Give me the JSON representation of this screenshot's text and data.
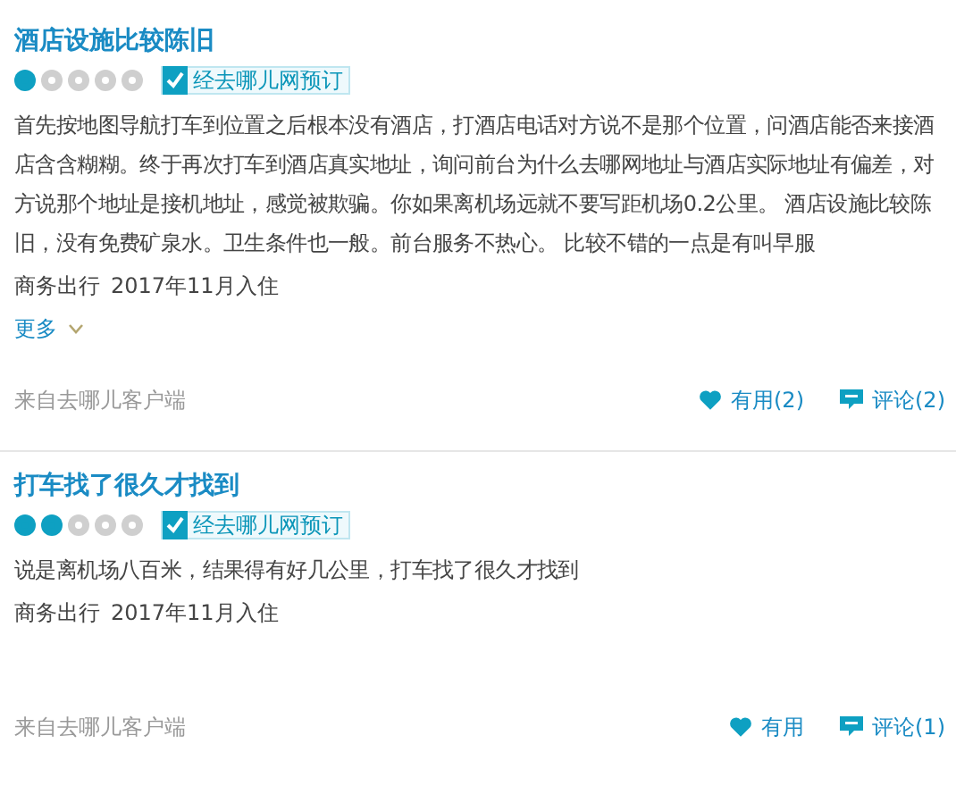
{
  "reviews": [
    {
      "title": "酒店设施比较陈旧",
      "stars": 1,
      "badge": "经去哪儿网预订",
      "body": "首先按地图导航打车到位置之后根本没有酒店，打酒店电话对方说不是那个位置，问酒店能否来接酒店含含糊糊。终于再次打车到酒店真实地址，询问前台为什么去哪网地址与酒店实际地址有偏差，对方说那个地址是接机地址，感觉被欺骗。你如果离机场远就不要写距机场0.2公里。 酒店设施比较陈旧，没有免费矿泉水。卫生条件也一般。前台服务不热心。 比较不错的一点是有叫早服",
      "trip_type": "商务出行",
      "stay_date": "2017年11月入住",
      "more": "更多",
      "source": "来自去哪儿客户端",
      "useful": "有用(2)",
      "comment": "评论(2)"
    },
    {
      "title": "打车找了很久才找到",
      "stars": 2,
      "badge": "经去哪儿网预订",
      "body": "说是离机场八百米，结果得有好几公里，打车找了很久才找到",
      "trip_type": "商务出行",
      "stay_date": "2017年11月入住",
      "source": "来自去哪儿客户端",
      "useful": "有用",
      "comment": "评论(1)"
    }
  ]
}
